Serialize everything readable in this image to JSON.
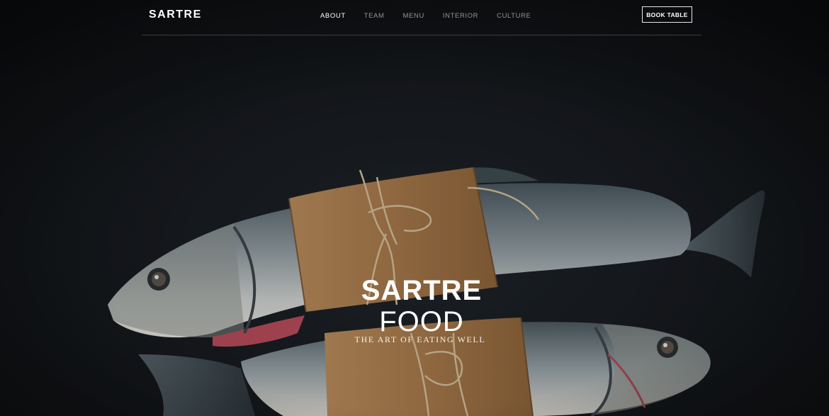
{
  "header": {
    "logo": "SARTRE",
    "nav": [
      {
        "label": "ABOUT",
        "active": true
      },
      {
        "label": "TEAM",
        "active": false
      },
      {
        "label": "MENU",
        "active": false
      },
      {
        "label": "INTERIOR",
        "active": false
      },
      {
        "label": "CULTURE",
        "active": false
      }
    ],
    "cta_label": "BOOK TABLE"
  },
  "hero": {
    "title_line1": "SARTRE",
    "title_line2": "FOOD",
    "tagline": "THE ART OF EATING WELL"
  },
  "colors": {
    "background": "#16191d",
    "nav_inactive": "#8f949a",
    "text": "#ffffff",
    "kraft_paper": "#a07548"
  }
}
